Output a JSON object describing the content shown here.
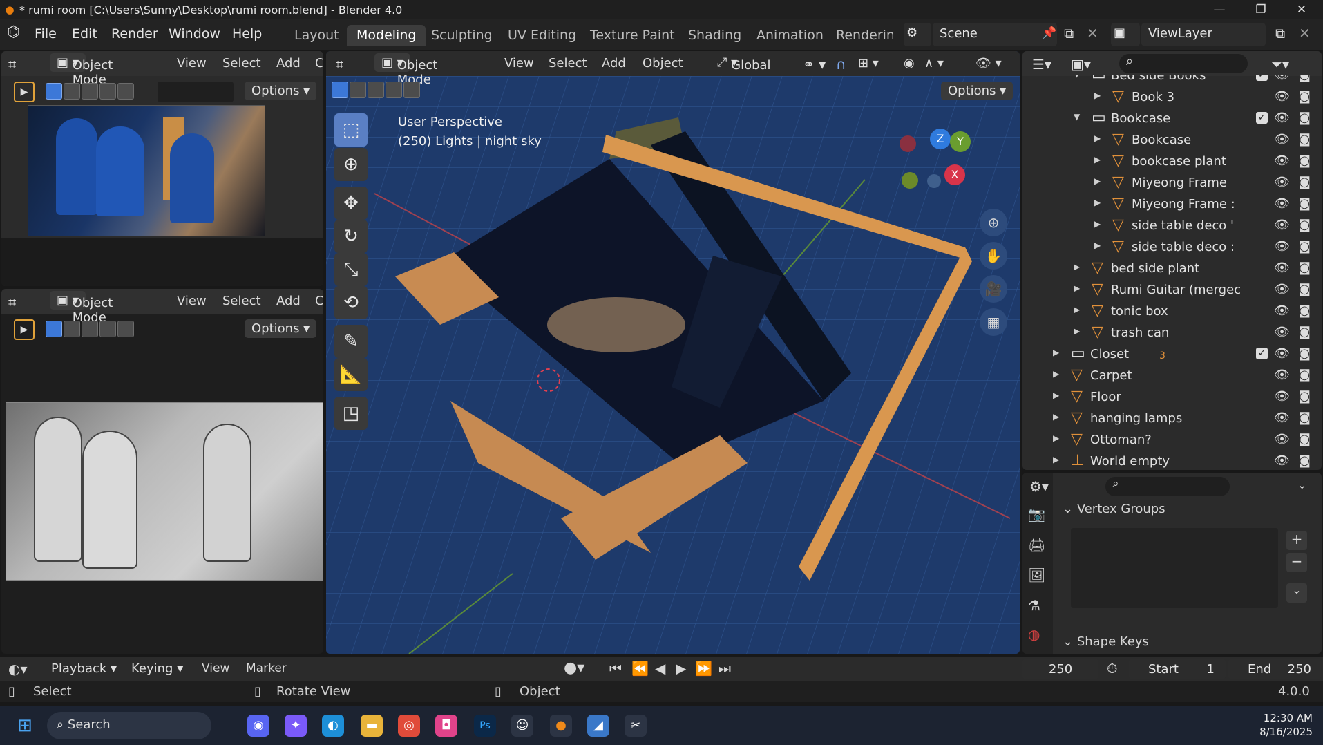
{
  "titlebar": {
    "title": "* rumi room [C:\\Users\\Sunny\\Desktop\\rumi room.blend] - Blender 4.0",
    "minimize": "—",
    "maximize": "❐",
    "close": "✕"
  },
  "menus": [
    "File",
    "Edit",
    "Render",
    "Window",
    "Help"
  ],
  "workspaces": [
    {
      "label": "Layout",
      "active": false
    },
    {
      "label": "Modeling",
      "active": true
    },
    {
      "label": "Sculpting",
      "active": false
    },
    {
      "label": "UV Editing",
      "active": false
    },
    {
      "label": "Texture Paint",
      "active": false
    },
    {
      "label": "Shading",
      "active": false
    },
    {
      "label": "Animation",
      "active": false
    },
    {
      "label": "Rendering",
      "active": false
    }
  ],
  "scene": {
    "label": "Scene"
  },
  "view_layer": {
    "label": "ViewLayer"
  },
  "left_top": {
    "mode": "Object Mode",
    "view": "View",
    "select": "Select",
    "add": "Add",
    "more": "C",
    "options": "Options"
  },
  "left_bottom": {
    "mode": "Object Mode",
    "view": "View",
    "select": "Select",
    "add": "Add",
    "more": "C",
    "options": "Options"
  },
  "viewport": {
    "mode": "Object Mode",
    "view": "View",
    "select": "Select",
    "add": "Add",
    "object": "Object",
    "orientation": "Global",
    "options": "Options",
    "perspective": "User Perspective",
    "info": "(250) Lights | night sky",
    "gizmo": {
      "z": "Z",
      "y": "Y",
      "x": "X"
    }
  },
  "outliner": {
    "rows": [
      {
        "label": "Bed side Books",
        "indent": 3,
        "expanded": true,
        "icon": "collection",
        "check": true
      },
      {
        "label": "Book 3",
        "indent": 4,
        "expanded": false,
        "icon": "object"
      },
      {
        "label": "Bookcase",
        "indent": 3,
        "expanded": true,
        "icon": "collection",
        "check": true
      },
      {
        "label": "Bookcase",
        "indent": 4,
        "expanded": false,
        "icon": "object"
      },
      {
        "label": "bookcase plant",
        "indent": 4,
        "expanded": false,
        "icon": "object"
      },
      {
        "label": "Miyeong Frame",
        "indent": 4,
        "expanded": false,
        "icon": "object"
      },
      {
        "label": "Miyeong Frame :",
        "indent": 4,
        "expanded": false,
        "icon": "object"
      },
      {
        "label": "side table deco '",
        "indent": 4,
        "expanded": false,
        "icon": "object"
      },
      {
        "label": "side table deco :",
        "indent": 4,
        "expanded": false,
        "icon": "object"
      },
      {
        "label": "bed side plant",
        "indent": 3,
        "expanded": false,
        "icon": "object"
      },
      {
        "label": "Rumi Guitar (mergec",
        "indent": 3,
        "expanded": false,
        "icon": "object"
      },
      {
        "label": "tonic box",
        "indent": 3,
        "expanded": false,
        "icon": "object"
      },
      {
        "label": "trash can",
        "indent": 3,
        "expanded": false,
        "icon": "object"
      },
      {
        "label": "Closet",
        "indent": 2,
        "expanded": false,
        "icon": "collection",
        "check": true,
        "sub": "3"
      },
      {
        "label": "Carpet",
        "indent": 2,
        "expanded": false,
        "icon": "object"
      },
      {
        "label": "Floor",
        "indent": 2,
        "expanded": false,
        "icon": "object"
      },
      {
        "label": "hanging lamps",
        "indent": 2,
        "expanded": false,
        "icon": "object"
      },
      {
        "label": "Ottoman?",
        "indent": 2,
        "expanded": false,
        "icon": "object"
      },
      {
        "label": "World empty",
        "indent": 2,
        "expanded": false,
        "icon": "empty"
      }
    ]
  },
  "properties": {
    "vertex_groups": "Vertex Groups",
    "shape_keys": "Shape Keys"
  },
  "timeline": {
    "playback": "Playback",
    "keying": "Keying",
    "view": "View",
    "marker": "Marker",
    "frame": "250",
    "start_label": "Start",
    "start": "1",
    "end_label": "End",
    "end": "250"
  },
  "status": {
    "select": "Select",
    "rotate": "Rotate View",
    "object": "Object",
    "version": "4.0.0"
  },
  "taskbar": {
    "search": "Search",
    "time": "12:30 AM",
    "date": "8/16/2025"
  },
  "colors": {
    "accent": "#3c78d8",
    "orange": "#e0903a",
    "bg": "#181818",
    "panel": "#2b2b2b"
  }
}
